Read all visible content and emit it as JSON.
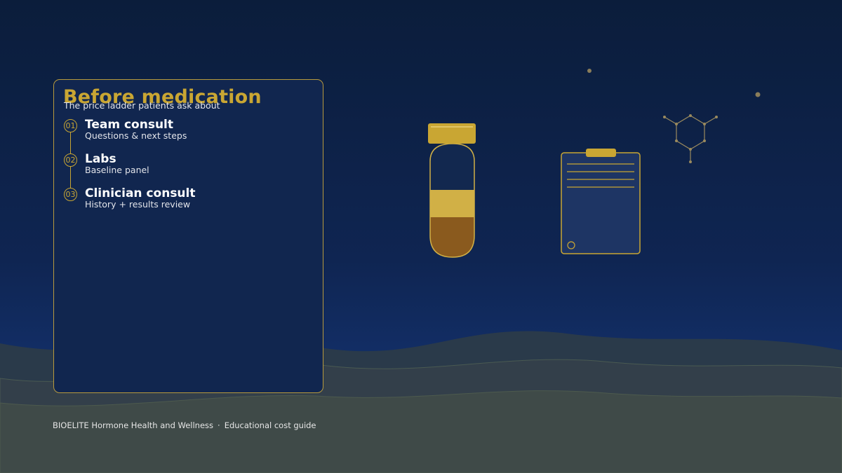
{
  "card": {
    "title": "Before medication",
    "subtitle": "The price ladder patients ask about",
    "steps": [
      {
        "number": "01",
        "title": "Team consult",
        "description": "Questions & next steps"
      },
      {
        "number": "02",
        "title": "Labs",
        "description": "Baseline panel"
      },
      {
        "number": "03",
        "title": "Clinician consult",
        "description": "History + results review"
      }
    ]
  },
  "footer": {
    "brand": "BIOELITE Hormone Health and Wellness",
    "separator": "·",
    "caption": "Educational cost guide"
  },
  "colors": {
    "accent_gold": "#c9a633",
    "background_navy": "#0f2552",
    "hill_color": "#3f4a4a"
  },
  "icons": [
    "test-tube-icon",
    "clipboard-icon",
    "molecule-icon"
  ]
}
